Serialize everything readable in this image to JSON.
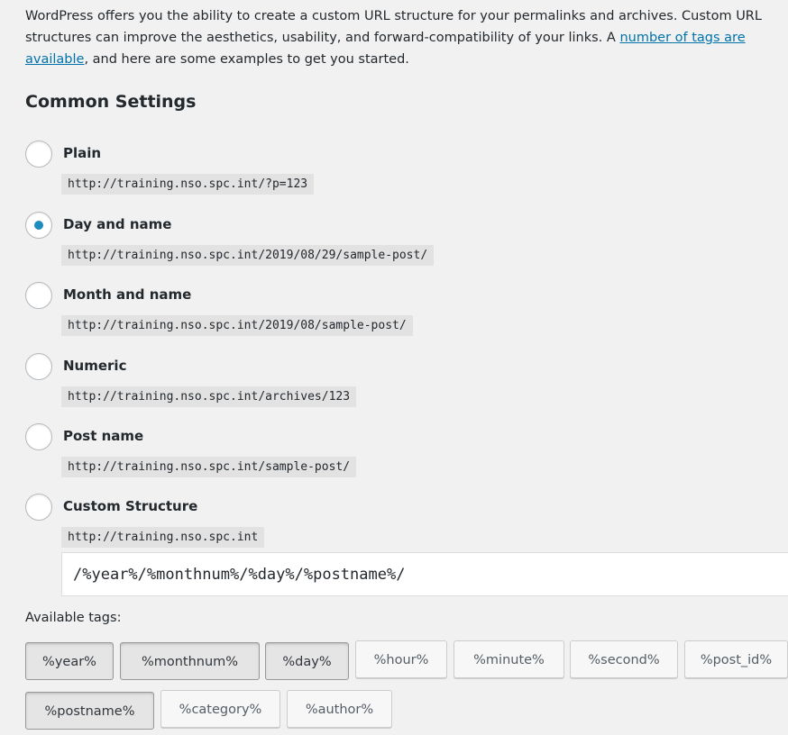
{
  "intro": {
    "text_before": "WordPress offers you the ability to create a custom URL structure for your permalinks and archives. Custom URL structures can improve the aesthetics, usability, and forward-compatibility of your links. A ",
    "link_text": "number of tags are available",
    "text_after": ", and here are some examples to get you started."
  },
  "section_title": "Common Settings",
  "options": [
    {
      "label": "Plain",
      "example": "http://training.nso.spc.int/?p=123",
      "checked": false
    },
    {
      "label": "Day and name",
      "example": "http://training.nso.spc.int/2019/08/29/sample-post/",
      "checked": true
    },
    {
      "label": "Month and name",
      "example": "http://training.nso.spc.int/2019/08/sample-post/",
      "checked": false
    },
    {
      "label": "Numeric",
      "example": "http://training.nso.spc.int/archives/123",
      "checked": false
    },
    {
      "label": "Post name",
      "example": "http://training.nso.spc.int/sample-post/",
      "checked": false
    },
    {
      "label": "Custom Structure",
      "example": "http://training.nso.spc.int",
      "checked": false
    }
  ],
  "custom_structure_value": "/%year%/%monthnum%/%day%/%postname%/",
  "available_tags_label": "Available tags:",
  "tags": [
    {
      "label": "%year%",
      "active": true
    },
    {
      "label": "%monthnum%",
      "active": true
    },
    {
      "label": "%day%",
      "active": true
    },
    {
      "label": "%hour%",
      "active": false
    },
    {
      "label": "%minute%",
      "active": false
    },
    {
      "label": "%second%",
      "active": false
    },
    {
      "label": "%post_id%",
      "active": false
    },
    {
      "label": "%postname%",
      "active": true
    },
    {
      "label": "%category%",
      "active": false
    },
    {
      "label": "%author%",
      "active": false
    }
  ],
  "colors": {
    "background": "#f1f1f1",
    "link": "#0073aa",
    "radio_checked": "#1e8cbe",
    "code_background": "#e2e2e2",
    "text": "#23282d"
  }
}
